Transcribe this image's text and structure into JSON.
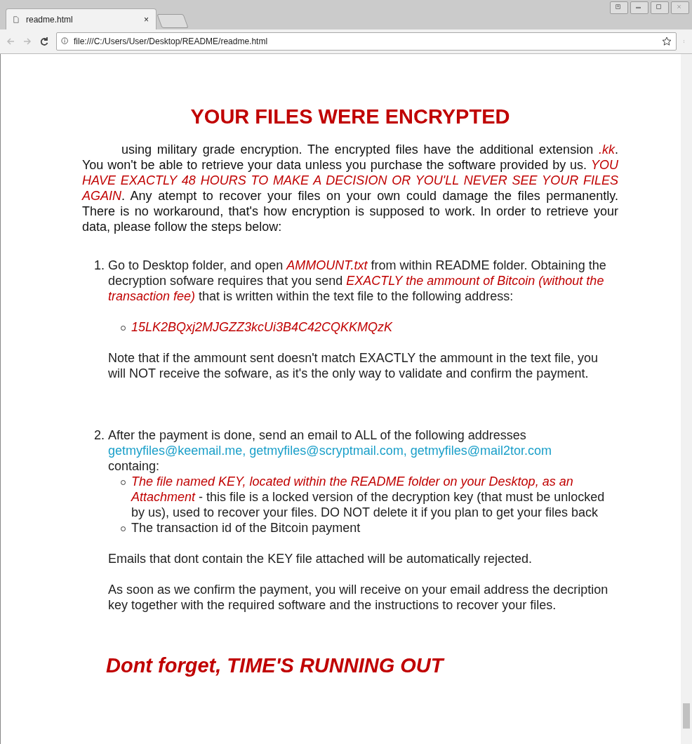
{
  "tab": {
    "title": "readme.html",
    "close": "×",
    "selected": true
  },
  "address": "file:///C:/Users/User/Desktop/README/readme.html",
  "heading": "YOUR FILES WERE ENCRYPTED",
  "intro": "using military grade encryption. The encrypted files have the additional extension *.kk*. You won't be able to retrieve your data unless you purchase the software provided by us. *YOU HAVE EXACTLY 48 HOURS TO MAKE A DECISION OR YOU'LL NEVER SEE YOUR FILES AGAIN*. Any atempt to recover your files on your own could damage the files permanently. There is no workaround, that's how encryption is supposed to work. In order to retrieve your data, please follow the steps below:",
  "steps": [
    {
      "number": "1.",
      "text": "Go to Desktop folder, and open *AMMOUNT.txt* from within README folder. Obtaining the decryption sofware requires that you send *EXACTLY the ammount of Bitcoin (without the transaction fee)* that is written within the text file to the following address:",
      "address": "15LK2BQxj2MJGZZ3kcUi3B4C42CQKKMQzK",
      "note": "Note that if the ammount sent doesn't match EXACTLY the ammount in the text file, you will NOT receive the sofware, as it's the only way to validate and confirm the payment."
    },
    {
      "number": "2.",
      "text": "After the payment is done, send an email to ALL of the following addresses",
      "emails": [
        "getmyfiles@keemail.me,",
        "getmyfiles@scryptmail.com,",
        "getmyfiles@mail2tor.com"
      ],
      "after": "containg:",
      "bullets": [
        "*The file named KEY, located within the README folder on your Desktop, as an Attachment* - this file is a locked version of the decryption key (that must be unlocked by us), used to recover your files. DO NOT delete it if you plan to get your files back",
        "The transaction id of the Bitcoin payment"
      ],
      "notes": [
        "Emails that dont contain the KEY file attached will be automatically rejected.",
        "As soon as we confirm the payment, you will receive on your email address the decription key together with the required software and the instructions to recover your files."
      ]
    }
  ],
  "closing": "Dont forget, TIME'S RUNNING OUT"
}
